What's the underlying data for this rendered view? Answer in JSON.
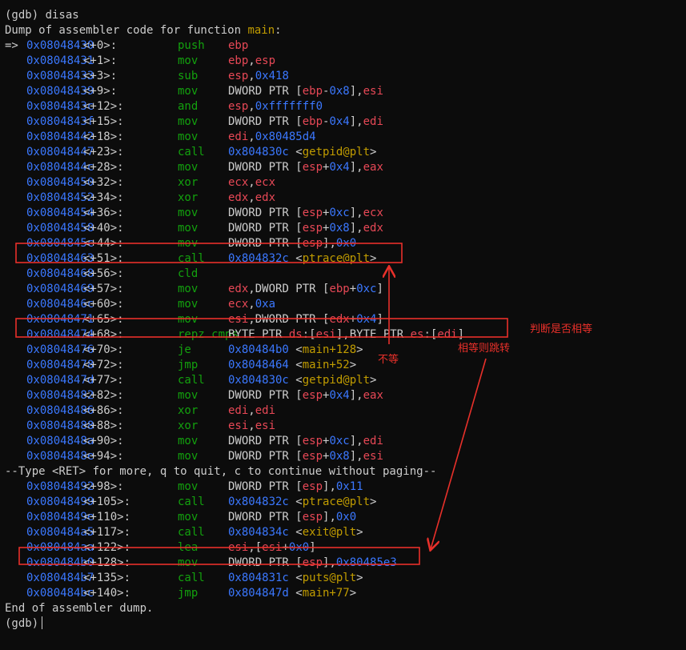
{
  "terminal": {
    "lines": [
      {
        "kind": "text",
        "parts": [
          {
            "t": "(gdb) disas",
            "c": "plain"
          }
        ]
      },
      {
        "kind": "text",
        "parts": [
          {
            "t": "Dump of assembler code for function ",
            "c": "plain"
          },
          {
            "t": "main",
            "c": "fn"
          },
          {
            "t": ":",
            "c": "plain"
          }
        ]
      },
      {
        "kind": "asm",
        "current": true,
        "addr": "0x08048430",
        "off": "<+0>:",
        "mn": "push",
        "ops": [
          {
            "t": "ebp",
            "c": "reg"
          }
        ]
      },
      {
        "kind": "asm",
        "addr": "0x08048431",
        "off": "<+1>:",
        "mn": "mov",
        "ops": [
          {
            "t": "ebp",
            "c": "reg"
          },
          {
            "t": ",",
            "c": "plain"
          },
          {
            "t": "esp",
            "c": "reg"
          }
        ]
      },
      {
        "kind": "asm",
        "addr": "0x08048433",
        "off": "<+3>:",
        "mn": "sub",
        "ops": [
          {
            "t": "esp",
            "c": "reg"
          },
          {
            "t": ",",
            "c": "plain"
          },
          {
            "t": "0x418",
            "c": "num"
          }
        ]
      },
      {
        "kind": "asm",
        "addr": "0x08048439",
        "off": "<+9>:",
        "mn": "mov",
        "ops": [
          {
            "t": "DWORD PTR [",
            "c": "plain"
          },
          {
            "t": "ebp",
            "c": "reg"
          },
          {
            "t": "-",
            "c": "plain"
          },
          {
            "t": "0x8",
            "c": "num"
          },
          {
            "t": "],",
            "c": "plain"
          },
          {
            "t": "esi",
            "c": "reg"
          }
        ]
      },
      {
        "kind": "asm",
        "addr": "0x0804843c",
        "off": "<+12>:",
        "mn": "and",
        "ops": [
          {
            "t": "esp",
            "c": "reg"
          },
          {
            "t": ",",
            "c": "plain"
          },
          {
            "t": "0xfffffff0",
            "c": "num"
          }
        ]
      },
      {
        "kind": "asm",
        "addr": "0x0804843f",
        "off": "<+15>:",
        "mn": "mov",
        "ops": [
          {
            "t": "DWORD PTR [",
            "c": "plain"
          },
          {
            "t": "ebp",
            "c": "reg"
          },
          {
            "t": "-",
            "c": "plain"
          },
          {
            "t": "0x4",
            "c": "num"
          },
          {
            "t": "],",
            "c": "plain"
          },
          {
            "t": "edi",
            "c": "reg"
          }
        ]
      },
      {
        "kind": "asm",
        "addr": "0x08048442",
        "off": "<+18>:",
        "mn": "mov",
        "ops": [
          {
            "t": "edi",
            "c": "reg"
          },
          {
            "t": ",",
            "c": "plain"
          },
          {
            "t": "0x80485d4",
            "c": "num"
          }
        ]
      },
      {
        "kind": "asm",
        "addr": "0x08048447",
        "off": "<+23>:",
        "mn": "call",
        "ops": [
          {
            "t": "0x804830c",
            "c": "num"
          },
          {
            "t": " <",
            "c": "plain"
          },
          {
            "t": "getpid@plt",
            "c": "sym"
          },
          {
            "t": ">",
            "c": "plain"
          }
        ]
      },
      {
        "kind": "asm",
        "addr": "0x0804844c",
        "off": "<+28>:",
        "mn": "mov",
        "ops": [
          {
            "t": "DWORD PTR [",
            "c": "plain"
          },
          {
            "t": "esp",
            "c": "reg"
          },
          {
            "t": "+",
            "c": "plain"
          },
          {
            "t": "0x4",
            "c": "num"
          },
          {
            "t": "],",
            "c": "plain"
          },
          {
            "t": "eax",
            "c": "reg"
          }
        ]
      },
      {
        "kind": "asm",
        "addr": "0x08048450",
        "off": "<+32>:",
        "mn": "xor",
        "ops": [
          {
            "t": "ecx",
            "c": "reg"
          },
          {
            "t": ",",
            "c": "plain"
          },
          {
            "t": "ecx",
            "c": "reg"
          }
        ]
      },
      {
        "kind": "asm",
        "addr": "0x08048452",
        "off": "<+34>:",
        "mn": "xor",
        "ops": [
          {
            "t": "edx",
            "c": "reg"
          },
          {
            "t": ",",
            "c": "plain"
          },
          {
            "t": "edx",
            "c": "reg"
          }
        ]
      },
      {
        "kind": "asm",
        "addr": "0x08048454",
        "off": "<+36>:",
        "mn": "mov",
        "ops": [
          {
            "t": "DWORD PTR [",
            "c": "plain"
          },
          {
            "t": "esp",
            "c": "reg"
          },
          {
            "t": "+",
            "c": "plain"
          },
          {
            "t": "0xc",
            "c": "num"
          },
          {
            "t": "],",
            "c": "plain"
          },
          {
            "t": "ecx",
            "c": "reg"
          }
        ]
      },
      {
        "kind": "asm",
        "addr": "0x08048458",
        "off": "<+40>:",
        "mn": "mov",
        "ops": [
          {
            "t": "DWORD PTR [",
            "c": "plain"
          },
          {
            "t": "esp",
            "c": "reg"
          },
          {
            "t": "+",
            "c": "plain"
          },
          {
            "t": "0x8",
            "c": "num"
          },
          {
            "t": "],",
            "c": "plain"
          },
          {
            "t": "edx",
            "c": "reg"
          }
        ]
      },
      {
        "kind": "asm",
        "addr": "0x0804845c",
        "off": "<+44>:",
        "mn": "mov",
        "ops": [
          {
            "t": "DWORD PTR [",
            "c": "plain"
          },
          {
            "t": "esp",
            "c": "reg"
          },
          {
            "t": "],",
            "c": "plain"
          },
          {
            "t": "0x0",
            "c": "num"
          }
        ]
      },
      {
        "kind": "asm",
        "addr": "0x08048463",
        "off": "<+51>:",
        "mn": "call",
        "ops": [
          {
            "t": "0x804832c",
            "c": "num"
          },
          {
            "t": " <",
            "c": "plain"
          },
          {
            "t": "ptrace@plt",
            "c": "sym"
          },
          {
            "t": ">",
            "c": "plain"
          }
        ]
      },
      {
        "kind": "asm",
        "addr": "0x08048468",
        "off": "<+56>:",
        "mn": "cld",
        "ops": []
      },
      {
        "kind": "asm",
        "addr": "0x08048469",
        "off": "<+57>:",
        "mn": "mov",
        "ops": [
          {
            "t": "edx",
            "c": "reg"
          },
          {
            "t": ",DWORD PTR [",
            "c": "plain"
          },
          {
            "t": "ebp",
            "c": "reg"
          },
          {
            "t": "+",
            "c": "plain"
          },
          {
            "t": "0xc",
            "c": "num"
          },
          {
            "t": "]",
            "c": "plain"
          }
        ]
      },
      {
        "kind": "asm",
        "addr": "0x0804846c",
        "off": "<+60>:",
        "mn": "mov",
        "ops": [
          {
            "t": "ecx",
            "c": "reg"
          },
          {
            "t": ",",
            "c": "plain"
          },
          {
            "t": "0xa",
            "c": "num"
          }
        ]
      },
      {
        "kind": "asm",
        "addr": "0x08048471",
        "off": "<+65>:",
        "mn": "mov",
        "ops": [
          {
            "t": "esi",
            "c": "reg"
          },
          {
            "t": ",DWORD PTR [",
            "c": "plain"
          },
          {
            "t": "edx",
            "c": "reg"
          },
          {
            "t": "+",
            "c": "plain"
          },
          {
            "t": "0x4",
            "c": "num"
          },
          {
            "t": "]",
            "c": "plain"
          }
        ]
      },
      {
        "kind": "asm",
        "addr": "0x08048474",
        "off": "<+68>:",
        "mn": "repz cmps",
        "ops": [
          {
            "t": "BYTE PTR ",
            "c": "plain"
          },
          {
            "t": "ds",
            "c": "reg"
          },
          {
            "t": ":[",
            "c": "plain"
          },
          {
            "t": "esi",
            "c": "reg"
          },
          {
            "t": "],BYTE PTR ",
            "c": "plain"
          },
          {
            "t": "es",
            "c": "reg"
          },
          {
            "t": ":[",
            "c": "plain"
          },
          {
            "t": "edi",
            "c": "reg"
          },
          {
            "t": "]",
            "c": "plain"
          }
        ]
      },
      {
        "kind": "asm",
        "addr": "0x08048476",
        "off": "<+70>:",
        "mn": "je",
        "ops": [
          {
            "t": "0x80484b0",
            "c": "num"
          },
          {
            "t": " <",
            "c": "plain"
          },
          {
            "t": "main+128",
            "c": "sym"
          },
          {
            "t": ">",
            "c": "plain"
          }
        ]
      },
      {
        "kind": "asm",
        "addr": "0x08048478",
        "off": "<+72>:",
        "mn": "jmp",
        "ops": [
          {
            "t": "0x8048464",
            "c": "num"
          },
          {
            "t": " <",
            "c": "plain"
          },
          {
            "t": "main+52",
            "c": "sym"
          },
          {
            "t": ">",
            "c": "plain"
          }
        ]
      },
      {
        "kind": "asm",
        "addr": "0x0804847d",
        "off": "<+77>:",
        "mn": "call",
        "ops": [
          {
            "t": "0x804830c",
            "c": "num"
          },
          {
            "t": " <",
            "c": "plain"
          },
          {
            "t": "getpid@plt",
            "c": "sym"
          },
          {
            "t": ">",
            "c": "plain"
          }
        ]
      },
      {
        "kind": "asm",
        "addr": "0x08048482",
        "off": "<+82>:",
        "mn": "mov",
        "ops": [
          {
            "t": "DWORD PTR [",
            "c": "plain"
          },
          {
            "t": "esp",
            "c": "reg"
          },
          {
            "t": "+",
            "c": "plain"
          },
          {
            "t": "0x4",
            "c": "num"
          },
          {
            "t": "],",
            "c": "plain"
          },
          {
            "t": "eax",
            "c": "reg"
          }
        ]
      },
      {
        "kind": "asm",
        "addr": "0x08048486",
        "off": "<+86>:",
        "mn": "xor",
        "ops": [
          {
            "t": "edi",
            "c": "reg"
          },
          {
            "t": ",",
            "c": "plain"
          },
          {
            "t": "edi",
            "c": "reg"
          }
        ]
      },
      {
        "kind": "asm",
        "addr": "0x08048488",
        "off": "<+88>:",
        "mn": "xor",
        "ops": [
          {
            "t": "esi",
            "c": "reg"
          },
          {
            "t": ",",
            "c": "plain"
          },
          {
            "t": "esi",
            "c": "reg"
          }
        ]
      },
      {
        "kind": "asm",
        "addr": "0x0804848a",
        "off": "<+90>:",
        "mn": "mov",
        "ops": [
          {
            "t": "DWORD PTR [",
            "c": "plain"
          },
          {
            "t": "esp",
            "c": "reg"
          },
          {
            "t": "+",
            "c": "plain"
          },
          {
            "t": "0xc",
            "c": "num"
          },
          {
            "t": "],",
            "c": "plain"
          },
          {
            "t": "edi",
            "c": "reg"
          }
        ]
      },
      {
        "kind": "asm",
        "addr": "0x0804848e",
        "off": "<+94>:",
        "mn": "mov",
        "ops": [
          {
            "t": "DWORD PTR [",
            "c": "plain"
          },
          {
            "t": "esp",
            "c": "reg"
          },
          {
            "t": "+",
            "c": "plain"
          },
          {
            "t": "0x8",
            "c": "num"
          },
          {
            "t": "],",
            "c": "plain"
          },
          {
            "t": "esi",
            "c": "reg"
          }
        ]
      },
      {
        "kind": "text",
        "parts": [
          {
            "t": "--Type <RET> for more, q to quit, c to continue without paging--",
            "c": "plain"
          }
        ]
      },
      {
        "kind": "asm",
        "addr": "0x08048492",
        "off": "<+98>:",
        "mn": "mov",
        "ops": [
          {
            "t": "DWORD PTR [",
            "c": "plain"
          },
          {
            "t": "esp",
            "c": "reg"
          },
          {
            "t": "],",
            "c": "plain"
          },
          {
            "t": "0x11",
            "c": "num"
          }
        ]
      },
      {
        "kind": "asm",
        "addr": "0x08048499",
        "off": "<+105>:",
        "mn": "call",
        "ops": [
          {
            "t": "0x804832c",
            "c": "num"
          },
          {
            "t": " <",
            "c": "plain"
          },
          {
            "t": "ptrace@plt",
            "c": "sym"
          },
          {
            "t": ">",
            "c": "plain"
          }
        ]
      },
      {
        "kind": "asm",
        "addr": "0x0804849e",
        "off": "<+110>:",
        "mn": "mov",
        "ops": [
          {
            "t": "DWORD PTR [",
            "c": "plain"
          },
          {
            "t": "esp",
            "c": "reg"
          },
          {
            "t": "],",
            "c": "plain"
          },
          {
            "t": "0x0",
            "c": "num"
          }
        ]
      },
      {
        "kind": "asm",
        "addr": "0x080484a5",
        "off": "<+117>:",
        "mn": "call",
        "ops": [
          {
            "t": "0x804834c",
            "c": "num"
          },
          {
            "t": " <",
            "c": "plain"
          },
          {
            "t": "exit@plt",
            "c": "sym"
          },
          {
            "t": ">",
            "c": "plain"
          }
        ]
      },
      {
        "kind": "asm",
        "addr": "0x080484aa",
        "off": "<+122>:",
        "mn": "lea",
        "ops": [
          {
            "t": "esi",
            "c": "reg"
          },
          {
            "t": ",[",
            "c": "plain"
          },
          {
            "t": "esi",
            "c": "reg"
          },
          {
            "t": "+",
            "c": "plain"
          },
          {
            "t": "0x0",
            "c": "num"
          },
          {
            "t": "]",
            "c": "plain"
          }
        ]
      },
      {
        "kind": "asm",
        "addr": "0x080484b0",
        "off": "<+128>:",
        "mn": "mov",
        "ops": [
          {
            "t": "DWORD PTR [",
            "c": "plain"
          },
          {
            "t": "esp",
            "c": "reg"
          },
          {
            "t": "],",
            "c": "plain"
          },
          {
            "t": "0x80485e3",
            "c": "num"
          }
        ]
      },
      {
        "kind": "asm",
        "addr": "0x080484b7",
        "off": "<+135>:",
        "mn": "call",
        "ops": [
          {
            "t": "0x804831c",
            "c": "num"
          },
          {
            "t": " <",
            "c": "plain"
          },
          {
            "t": "puts@plt",
            "c": "sym"
          },
          {
            "t": ">",
            "c": "plain"
          }
        ]
      },
      {
        "kind": "asm",
        "addr": "0x080484bc",
        "off": "<+140>:",
        "mn": "jmp",
        "ops": [
          {
            "t": "0x804847d",
            "c": "num"
          },
          {
            "t": " <",
            "c": "plain"
          },
          {
            "t": "main+77",
            "c": "sym"
          },
          {
            "t": ">",
            "c": "plain"
          }
        ]
      },
      {
        "kind": "text",
        "parts": [
          {
            "t": "End of assembler dump.",
            "c": "plain"
          }
        ]
      },
      {
        "kind": "prompt",
        "parts": [
          {
            "t": "(gdb)",
            "c": "plain"
          }
        ]
      }
    ],
    "current_marker": "=>"
  },
  "annotations": {
    "judge_label": "判断是否相等",
    "jump_label": "相等则跳转",
    "not_equal_label": "不等",
    "color": "#e8302a"
  },
  "theme": {
    "background": "#0c0c0c",
    "text": "#cccccc",
    "address": "#3b78ff",
    "mnemonic": "#13a10e",
    "register": "#e74856",
    "number": "#3b78ff",
    "symbol": "#c19c00"
  }
}
